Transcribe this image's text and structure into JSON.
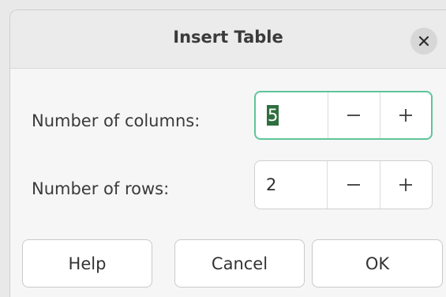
{
  "dialog": {
    "title": "Insert Table",
    "close_icon": "close-icon"
  },
  "fields": {
    "columns": {
      "label": "Number of columns:",
      "value": "5",
      "focused": true
    },
    "rows": {
      "label": "Number of rows:",
      "value": "2",
      "focused": false
    }
  },
  "spin_icons": {
    "decrement": "minus-icon",
    "increment": "plus-icon"
  },
  "buttons": {
    "help": "Help",
    "cancel": "Cancel",
    "ok": "OK"
  },
  "colors": {
    "focus_ring": "#5fc59a",
    "selection": "#2f6f3f"
  }
}
